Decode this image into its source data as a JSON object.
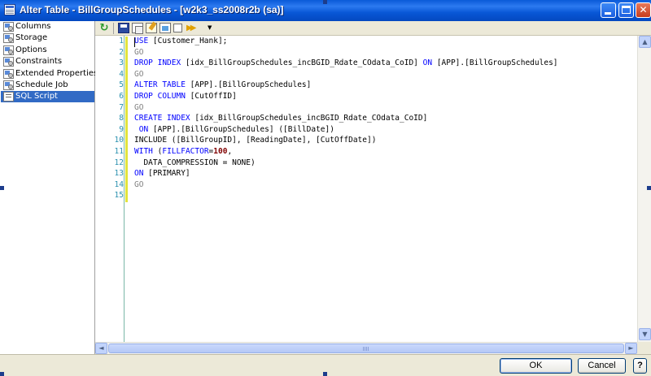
{
  "window": {
    "title": "Alter Table - BillGroupSchedules - [w2k3_ss2008r2b (sa)]"
  },
  "title_buttons": {
    "minimize": "",
    "maximize": "",
    "close": "✕"
  },
  "sidebar": {
    "items": [
      {
        "label": "Columns",
        "icon": "properties-page-icon",
        "selected": false
      },
      {
        "label": "Storage",
        "icon": "properties-page-icon",
        "selected": false
      },
      {
        "label": "Options",
        "icon": "properties-page-icon",
        "selected": false
      },
      {
        "label": "Constraints",
        "icon": "properties-page-icon",
        "selected": false
      },
      {
        "label": "Extended Properties",
        "icon": "properties-page-icon",
        "selected": false
      },
      {
        "label": "Schedule Job",
        "icon": "properties-page-icon",
        "selected": false
      },
      {
        "label": "SQL Script",
        "icon": "script-icon",
        "selected": true
      }
    ]
  },
  "toolbar": {
    "icons": [
      "refresh-icon",
      "save-icon",
      "copy-icon",
      "edit-script-icon",
      "parse-icon",
      "checkbox-icon",
      "run-icon",
      "dropdown-arrow-icon"
    ],
    "refresh_glyph": "↻",
    "run_glyph": "▶▶",
    "dropdown_glyph": "▼"
  },
  "editor": {
    "line_numbers": [
      "1",
      "2",
      "3",
      "4",
      "5",
      "6",
      "7",
      "8",
      "9",
      "10",
      "11",
      "12",
      "13",
      "14",
      "15"
    ],
    "lines": [
      [
        {
          "t": "USE",
          "c": "kw"
        },
        {
          "t": " [Customer_Hank];",
          "c": ""
        }
      ],
      [
        {
          "t": "GO",
          "c": "go"
        }
      ],
      [
        {
          "t": "DROP INDEX",
          "c": "kw"
        },
        {
          "t": " [idx_BillGroupSchedules_incBGID_Rdate_COdata_CoID] ",
          "c": ""
        },
        {
          "t": "ON",
          "c": "kw"
        },
        {
          "t": " [APP].[BillGroupSchedules]",
          "c": ""
        }
      ],
      [
        {
          "t": "GO",
          "c": "go"
        }
      ],
      [
        {
          "t": "ALTER TABLE",
          "c": "kw"
        },
        {
          "t": " [APP].[BillGroupSchedules]",
          "c": ""
        }
      ],
      [
        {
          "t": "DROP COLUMN",
          "c": "kw"
        },
        {
          "t": " [CutOffID]",
          "c": ""
        }
      ],
      [
        {
          "t": "GO",
          "c": "go"
        }
      ],
      [
        {
          "t": "CREATE INDEX",
          "c": "kw"
        },
        {
          "t": " [idx_BillGroupSchedules_incBGID_Rdate_COdata_CoID]",
          "c": ""
        }
      ],
      [
        {
          "t": " ON",
          "c": "kw"
        },
        {
          "t": " [APP].[BillGroupSchedules] ([BillDate])",
          "c": ""
        }
      ],
      [
        {
          "t": "INCLUDE ([BillGroupID], [ReadingDate], [CutOffDate])",
          "c": ""
        }
      ],
      [
        {
          "t": "WITH",
          "c": "kw"
        },
        {
          "t": " (",
          "c": ""
        },
        {
          "t": "FILLFACTOR",
          "c": "kw"
        },
        {
          "t": "=",
          "c": ""
        },
        {
          "t": "100",
          "c": "num"
        },
        {
          "t": ",",
          "c": ""
        }
      ],
      [
        {
          "t": "  DATA_COMPRESSION = NONE)",
          "c": ""
        }
      ],
      [
        {
          "t": "ON",
          "c": "kw"
        },
        {
          "t": " [PRIMARY]",
          "c": ""
        }
      ],
      [
        {
          "t": "GO",
          "c": "go"
        }
      ],
      []
    ]
  },
  "scrollbars": {
    "up": "▲",
    "down": "▼",
    "left": "◄",
    "right": "►"
  },
  "buttons": {
    "ok": "OK",
    "cancel": "Cancel",
    "help": "?"
  }
}
